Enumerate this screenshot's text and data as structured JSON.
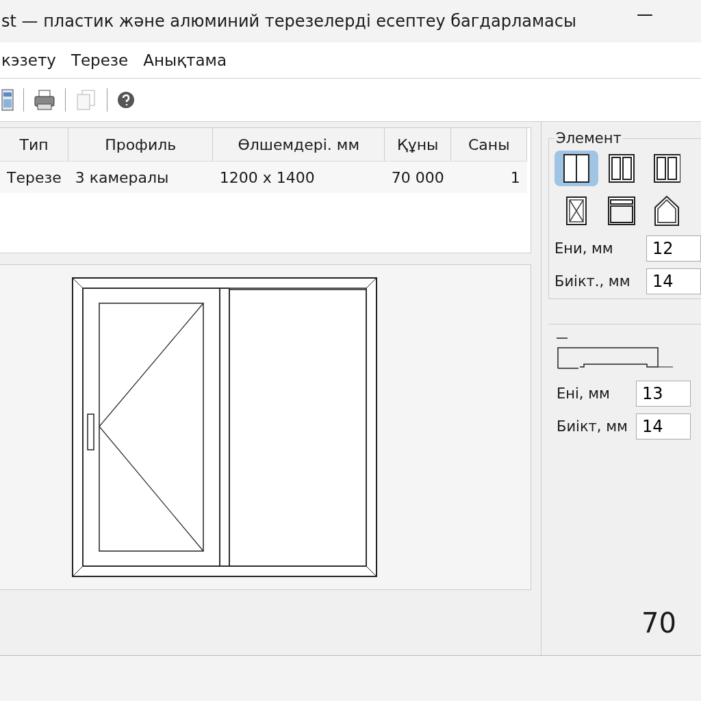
{
  "window": {
    "title": "st — пластик және алюминий терезелерді есептеу багдарламасы",
    "minimize": "—"
  },
  "menu": [
    {
      "label": "кэзету"
    },
    {
      "label": "Терезе"
    },
    {
      "label": "Анықтама"
    }
  ],
  "toolbar": [
    {
      "kind": "calc",
      "disabled": false
    },
    {
      "kind": "print",
      "disabled": false
    },
    {
      "kind": "copy",
      "disabled": true
    },
    {
      "kind": "help",
      "disabled": false
    }
  ],
  "table": {
    "columns": [
      "Тип",
      "Профиль",
      "Өлшемдері. мм",
      "Құны",
      "Саны"
    ],
    "rows": [
      [
        "Терезе",
        "3 камералы",
        "1200 x 1400",
        "70 000",
        "1"
      ]
    ]
  },
  "element_panel": {
    "title": "Элемент",
    "elements": [
      {
        "kind": "double",
        "selected": true
      },
      {
        "kind": "double-frame",
        "selected": false
      },
      {
        "kind": "triple",
        "selected": false
      },
      {
        "kind": "door",
        "selected": false
      },
      {
        "kind": "transom",
        "selected": false
      },
      {
        "kind": "gable",
        "selected": false
      }
    ],
    "fields": [
      {
        "label": "Ени, мм",
        "value": "12"
      },
      {
        "label": "Биікт., мм",
        "value": "14"
      }
    ]
  },
  "profile_panel": {
    "fields": [
      {
        "label": "Ені, мм",
        "value": "13"
      },
      {
        "label": "Биікт, мм",
        "value": "14"
      }
    ]
  },
  "total": "70"
}
